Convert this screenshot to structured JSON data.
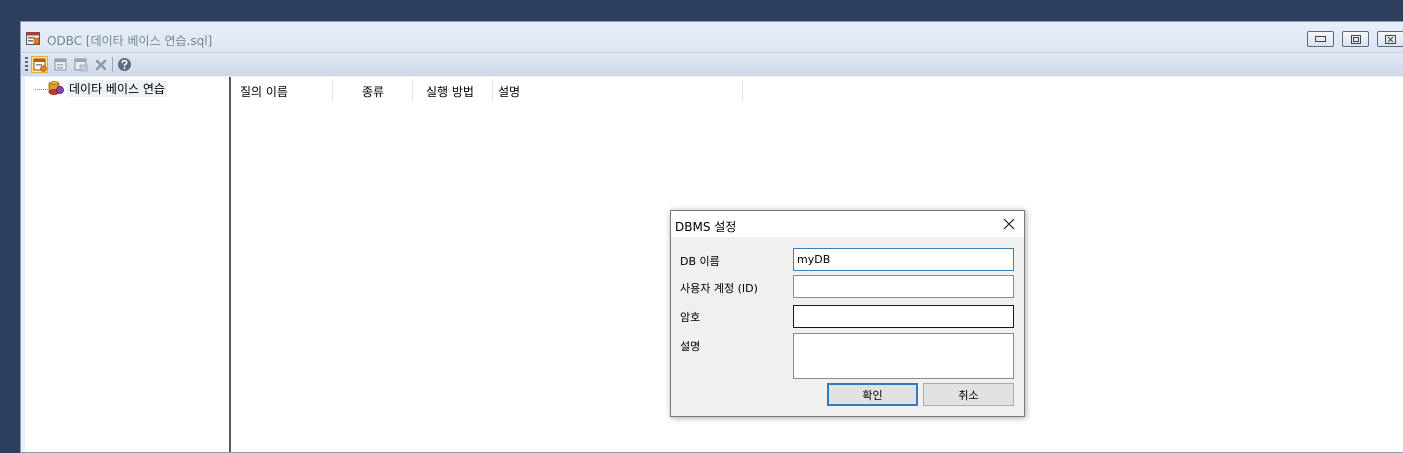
{
  "window": {
    "title": "ODBC [데이타 베이스 연습.sql]"
  },
  "toolbar": {
    "buttons": [
      "new-db-icon",
      "edit-db-icon",
      "db-settings-icon",
      "delete-icon",
      "help-icon"
    ]
  },
  "tree": {
    "root_label": "데이타 베이스 연습"
  },
  "list": {
    "columns": [
      "질의 이름",
      "종류",
      "실행 방법",
      "설명"
    ]
  },
  "dialog": {
    "title": "DBMS 설정",
    "fields": {
      "db_name_label": "DB 이름",
      "db_name_value": "myDB",
      "user_label": "사용자 계정 (ID)",
      "user_value": "",
      "password_label": "암호",
      "password_value": "",
      "desc_label": "설명",
      "desc_value": ""
    },
    "ok_label": "확인",
    "cancel_label": "취소"
  },
  "colors": {
    "desktop": "#2e3f5e",
    "accent_border": "#2f7cc4",
    "toolbar_active": "#fbe6a5"
  }
}
